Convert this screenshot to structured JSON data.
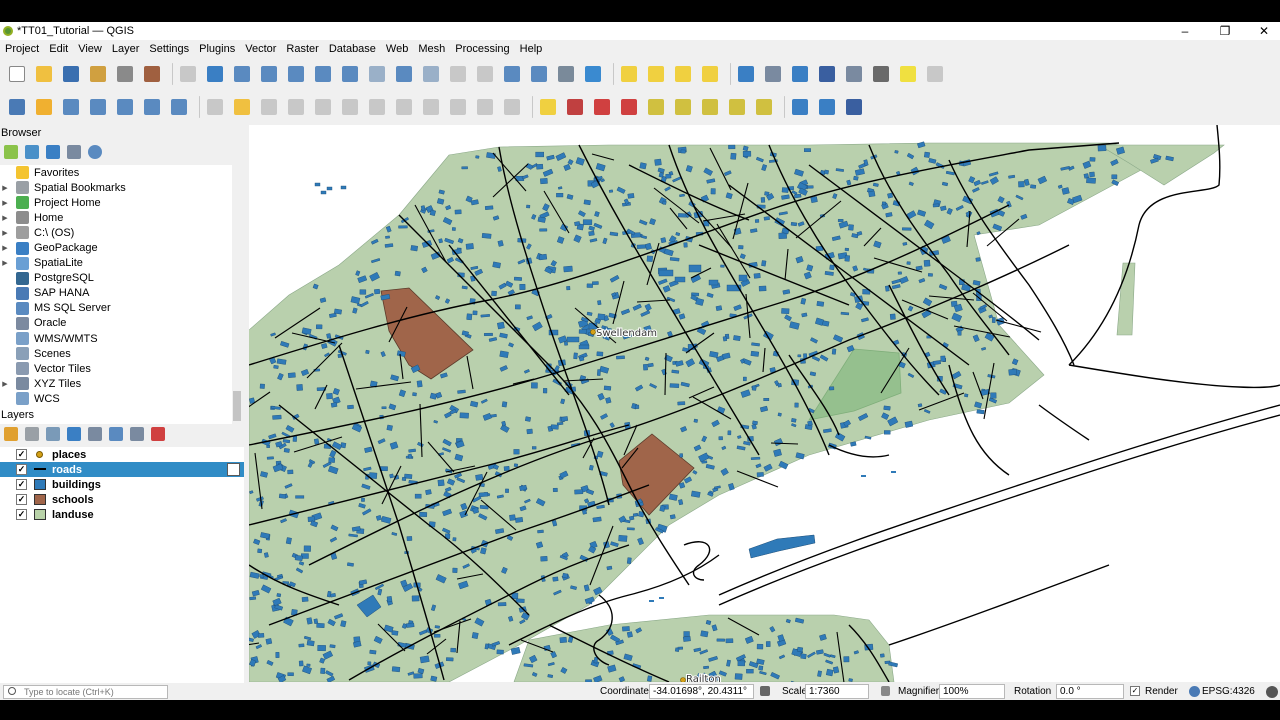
{
  "window": {
    "title": "*TT01_Tutorial — QGIS",
    "minimize": "–",
    "maximize": "❐",
    "close": "✕"
  },
  "menu": [
    "Project",
    "Edit",
    "View",
    "Layer",
    "Settings",
    "Plugins",
    "Vector",
    "Raster",
    "Database",
    "Web",
    "Mesh",
    "Processing",
    "Help"
  ],
  "browser": {
    "title": "Browser",
    "items": [
      {
        "label": "Favorites",
        "icon": "star-icon",
        "color": "#f4c430",
        "expandable": false
      },
      {
        "label": "Spatial Bookmarks",
        "icon": "bookmark-icon",
        "color": "#9aa0a6",
        "expandable": true
      },
      {
        "label": "Project Home",
        "icon": "project-home-icon",
        "color": "#4caf50",
        "expandable": true
      },
      {
        "label": "Home",
        "icon": "home-icon",
        "color": "#8d8d8d",
        "expandable": true
      },
      {
        "label": "C:\\ (OS)",
        "icon": "drive-icon",
        "color": "#9e9e9e",
        "expandable": true
      },
      {
        "label": "GeoPackage",
        "icon": "geopackage-icon",
        "color": "#3a7fc4",
        "expandable": true
      },
      {
        "label": "SpatiaLite",
        "icon": "spatialite-icon",
        "color": "#6a9fd4",
        "expandable": true
      },
      {
        "label": "PostgreSQL",
        "icon": "postgresql-icon",
        "color": "#336791",
        "expandable": false
      },
      {
        "label": "SAP HANA",
        "icon": "sap-hana-icon",
        "color": "#4a7ab5",
        "expandable": false
      },
      {
        "label": "MS SQL Server",
        "icon": "mssql-icon",
        "color": "#5a8ac0",
        "expandable": false
      },
      {
        "label": "Oracle",
        "icon": "oracle-icon",
        "color": "#7c8aa0",
        "expandable": false
      },
      {
        "label": "WMS/WMTS",
        "icon": "wms-icon",
        "color": "#7aa0c8",
        "expandable": false
      },
      {
        "label": "Scenes",
        "icon": "scenes-icon",
        "color": "#8aa0b8",
        "expandable": false
      },
      {
        "label": "Vector Tiles",
        "icon": "vector-tiles-icon",
        "color": "#8a9ab0",
        "expandable": false
      },
      {
        "label": "XYZ Tiles",
        "icon": "xyz-tiles-icon",
        "color": "#7a8aa0",
        "expandable": true
      },
      {
        "label": "WCS",
        "icon": "wcs-icon",
        "color": "#7aa0c8",
        "expandable": false
      }
    ]
  },
  "layers": {
    "title": "Layers",
    "items": [
      {
        "label": "places",
        "checked": "✓",
        "symbol": "point",
        "color": "#d4a017",
        "selected": false
      },
      {
        "label": "roads",
        "checked": "✓",
        "symbol": "line",
        "color": "#000000",
        "selected": true
      },
      {
        "label": "buildings",
        "checked": "✓",
        "symbol": "fill",
        "color": "#2f7ab8",
        "selected": false
      },
      {
        "label": "schools",
        "checked": "✓",
        "symbol": "fill",
        "color": "#a0654a",
        "selected": false
      },
      {
        "label": "landuse",
        "checked": "✓",
        "symbol": "fill",
        "color": "#b9d3a9",
        "selected": false
      }
    ]
  },
  "map": {
    "labels": [
      {
        "text": "Swellendam"
      },
      {
        "text": "Railton"
      }
    ],
    "colors": {
      "landuse": "#b9d0ad",
      "buildings": "#2f7ab8",
      "schools": "#a0654a",
      "roads": "#000000",
      "park": "#95c08e"
    }
  },
  "statusbar": {
    "locator_placeholder": "Type to locate (Ctrl+K)",
    "coordinate_label": "Coordinate",
    "coordinate_value": "-34.01698°, 20.4311°",
    "scale_label": "Scale",
    "scale_value": "1:7360",
    "magnifier_label": "Magnifier",
    "magnifier_value": "100%",
    "rotation_label": "Rotation",
    "rotation_value": "0.0 °",
    "render_label": "Render",
    "render_checked": "✓",
    "crs": "EPSG:4326"
  }
}
